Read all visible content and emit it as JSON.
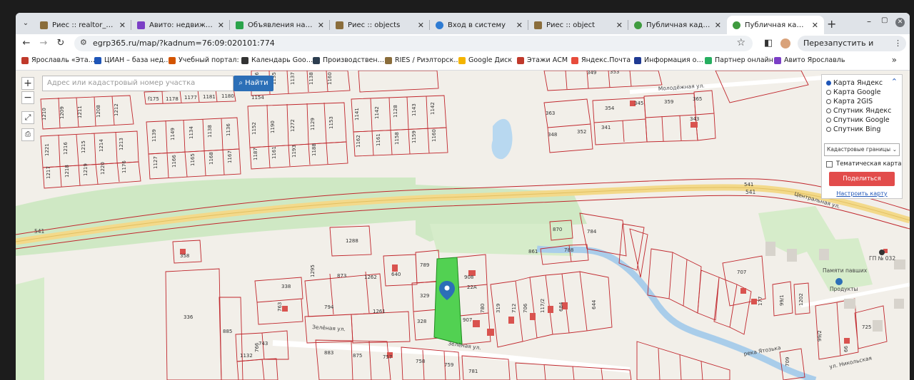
{
  "tabs": [
    {
      "title": "Риес :: realtor_window",
      "icon": "ries-icon",
      "color": "#8a6d3b"
    },
    {
      "title": "Авито: недвижимость",
      "icon": "avito-icon",
      "color": "#7b3fc6"
    },
    {
      "title": "Объявления на Авито",
      "icon": "avito-icon",
      "color": "#2aa34a"
    },
    {
      "title": "Риес :: objects",
      "icon": "ries-icon",
      "color": "#8a6d3b"
    },
    {
      "title": "Вход в систему",
      "icon": "globe-icon",
      "color": "#2f7cd3"
    },
    {
      "title": "Риес :: object",
      "icon": "ries-icon",
      "color": "#8a6d3b"
    },
    {
      "title": "Публичная кадастровая",
      "icon": "check-icon",
      "color": "#3f9b3f"
    },
    {
      "title": "Публичная кадастровая",
      "icon": "check-icon",
      "color": "#3f9b3f"
    }
  ],
  "toolbar": {
    "url": "egrp365.ru/map/?kadnum=76:09:020101:774",
    "relaunch_label": "Перезапустить и обновить"
  },
  "bookmarks": [
    {
      "label": "Ярославль «Эта…",
      "color": "#c0392b"
    },
    {
      "label": "ЦИАН – база нед…",
      "color": "#1f56b8"
    },
    {
      "label": "Учебный портал:",
      "color": "#d35400"
    },
    {
      "label": "Календарь Goo…",
      "color": "#333333"
    },
    {
      "label": "Производствен…",
      "color": "#2c3e50"
    },
    {
      "label": "RIES / Риэлторск…",
      "color": "#8a6d3b"
    },
    {
      "label": "Google Диск",
      "color": "#f4b400"
    },
    {
      "label": "Этажи АСМ",
      "color": "#c0392b"
    },
    {
      "label": "Яндекс.Почта",
      "color": "#e74c3c"
    },
    {
      "label": "Информация о…",
      "color": "#1f3a93"
    },
    {
      "label": "Партнер онлайн",
      "color": "#27ae60"
    },
    {
      "label": "Авито Ярославль",
      "color": "#7b3fc6"
    }
  ],
  "map": {
    "search_placeholder": "Адрес или кадастровый номер участка",
    "search_button": "Найти",
    "zoom_in": "+",
    "zoom_out": "−",
    "layers": [
      "Карта Яндекс",
      "Карта Google",
      "Карта 2GIS",
      "Спутник Яндекс",
      "Спутник Google",
      "Спутник Bing"
    ],
    "selected_layer": "Карта Яндекс",
    "overlay_select": "Кадастровые границы",
    "thematic_label": "Тематическая карта",
    "share_button": "Поделиться ссылкой",
    "configure_link": "Настроить карту",
    "streets": {
      "molodezhnaya": "Молодёжная ул.",
      "tsentralnaya": "Центральная ул.",
      "zelenaya": "Зелёная ул.",
      "nikolskaya": "ул. Никольская",
      "road_541": "541",
      "park": "Памяти павших",
      "stop": "ГП № 032",
      "shop": "Продукты",
      "river": "река Ятозька"
    },
    "parcels": [
      "1210",
      "1209",
      "1211",
      "1208",
      "1212",
      "f175",
      "1178",
      "1177",
      "1181",
      "1180",
      "1154",
      "1136",
      "1135",
      "1137",
      "1138",
      "1160",
      "1221",
      "1216",
      "1215",
      "1214",
      "1213",
      "1139",
      "1149",
      "1134",
      "1138",
      "1136",
      "1152",
      "1190",
      "1272",
      "1129",
      "1153",
      "1141",
      "1142",
      "1128",
      "1143",
      "1142",
      "1217",
      "1218",
      "1219",
      "1220",
      "1176",
      "1127",
      "1166",
      "1165",
      "1168",
      "1167",
      "1187",
      "1161",
      "1193",
      "1188",
      "1162",
      "1161",
      "1158",
      "1159",
      "1160",
      "363",
      "348",
      "352",
      "341",
      "354",
      "345",
      "359",
      "365",
      "343",
      "349",
      "353",
      "541",
      "870",
      "784",
      "788",
      "861",
      "1288",
      "358",
      "336",
      "338",
      "763",
      "885",
      "1295",
      "873",
      "1262",
      "640",
      "789",
      "908",
      "22A",
      "329",
      "794",
      "1261",
      "328",
      "907",
      "780",
      "319",
      "712",
      "706",
      "117/2",
      "684",
      "644",
      "743",
      "766",
      "1132",
      "883",
      "875",
      "757",
      "758",
      "759",
      "781",
      "707",
      "177",
      "99/1",
      "1202",
      "725",
      "66",
      "99/2",
      "709"
    ]
  }
}
